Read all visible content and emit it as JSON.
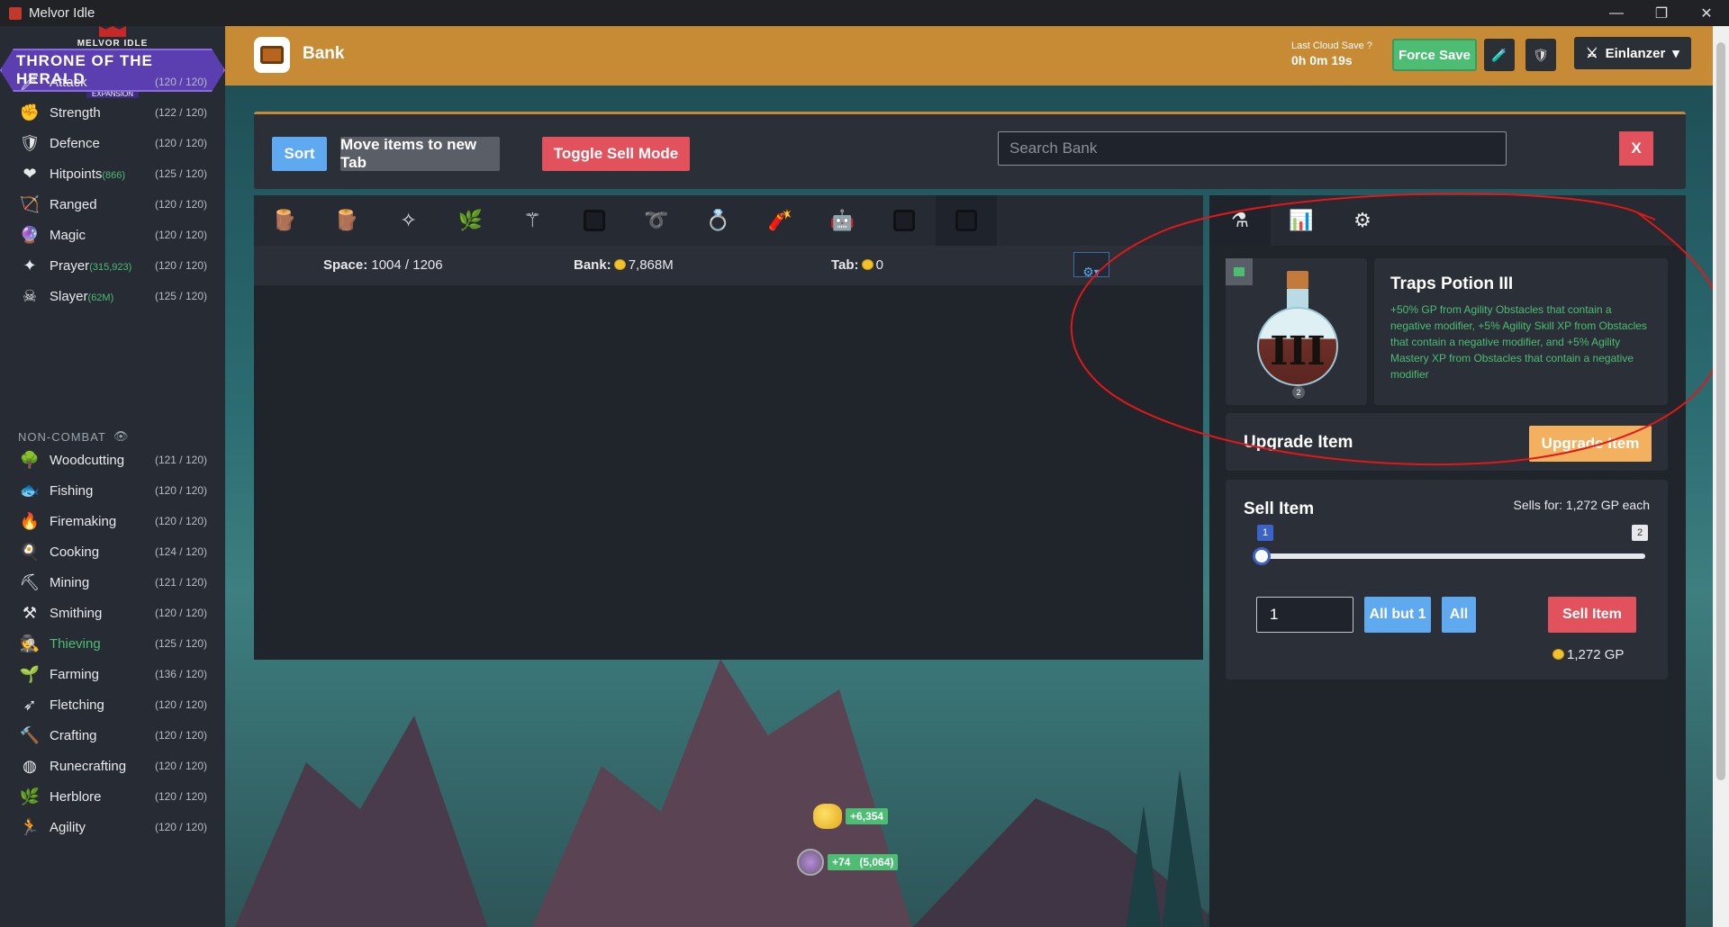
{
  "window": {
    "title": "Melvor Idle",
    "controls": [
      "—",
      "❐",
      "✕"
    ]
  },
  "logo": {
    "line1": "MELVOR IDLE",
    "line2": "THRONE OF THE HERALD",
    "line3": "EXPANSION"
  },
  "sidebar": {
    "combat": [
      {
        "name": "Attack",
        "extra": "",
        "level": "(120 / 120)",
        "icon": "sword-icon",
        "glyph": "🗡"
      },
      {
        "name": "Strength",
        "extra": "",
        "level": "(122 / 120)",
        "icon": "fist-icon",
        "glyph": "✊"
      },
      {
        "name": "Defence",
        "extra": "",
        "level": "(120 / 120)",
        "icon": "shield-icon",
        "glyph": "🛡"
      },
      {
        "name": "Hitpoints",
        "extra": "(866)",
        "level": "(125 / 120)",
        "icon": "heart-icon",
        "glyph": "❤"
      },
      {
        "name": "Ranged",
        "extra": "",
        "level": "(120 / 120)",
        "icon": "bow-icon",
        "glyph": "🏹"
      },
      {
        "name": "Magic",
        "extra": "",
        "level": "(120 / 120)",
        "icon": "wizard-hat-icon",
        "glyph": "🔮"
      },
      {
        "name": "Prayer",
        "extra": "(315,923)",
        "level": "(120 / 120)",
        "icon": "sparkle-icon",
        "glyph": "✦"
      },
      {
        "name": "Slayer",
        "extra": "(62M)",
        "level": "(125 / 120)",
        "icon": "slayer-icon",
        "glyph": "☠"
      }
    ],
    "noncombat_header": "NON-COMBAT",
    "noncombat": [
      {
        "name": "Woodcutting",
        "level": "(121 / 120)",
        "icon": "tree-icon",
        "glyph": "🌳"
      },
      {
        "name": "Fishing",
        "level": "(120 / 120)",
        "icon": "fish-icon",
        "glyph": "🐟"
      },
      {
        "name": "Firemaking",
        "level": "(120 / 120)",
        "icon": "fire-icon",
        "glyph": "🔥"
      },
      {
        "name": "Cooking",
        "level": "(124 / 120)",
        "icon": "chef-hat-icon",
        "glyph": "🍳"
      },
      {
        "name": "Mining",
        "level": "(121 / 120)",
        "icon": "pickaxe-icon",
        "glyph": "⛏"
      },
      {
        "name": "Smithing",
        "level": "(120 / 120)",
        "icon": "anvil-icon",
        "glyph": "⚒"
      },
      {
        "name": "Thieving",
        "level": "(125 / 120)",
        "icon": "thief-icon",
        "glyph": "🕵"
      },
      {
        "name": "Farming",
        "level": "(136 / 120)",
        "icon": "sprout-icon",
        "glyph": "🌱"
      },
      {
        "name": "Fletching",
        "level": "(120 / 120)",
        "icon": "arrow-icon",
        "glyph": "➶"
      },
      {
        "name": "Crafting",
        "level": "(120 / 120)",
        "icon": "tools-icon",
        "glyph": "🔨"
      },
      {
        "name": "Runecrafting",
        "level": "(120 / 120)",
        "icon": "rune-icon",
        "glyph": "◍"
      },
      {
        "name": "Herblore",
        "level": "(120 / 120)",
        "icon": "herb-icon",
        "glyph": "🌿"
      },
      {
        "name": "Agility",
        "level": "(120 / 120)",
        "icon": "runner-icon",
        "glyph": "🏃"
      }
    ]
  },
  "topbar": {
    "page_title": "Bank",
    "last_save_label": "Last Cloud Save",
    "last_save_value": "0h 0m 19s",
    "force_save": "Force Save",
    "username": "Einlanzer"
  },
  "bank": {
    "sort": "Sort",
    "move": "Move items to new Tab",
    "toggle_sell": "Toggle Sell Mode",
    "search_placeholder": "Search Bank",
    "search_clear": "X",
    "space_label": "Space:",
    "space_value": "1004 / 1206",
    "bank_label": "Bank:",
    "bank_value": "7,868M",
    "tab_label": "Tab:",
    "tab_value": "0",
    "tabs": [
      {
        "icon": "log-slice-icon",
        "glyph": "🪵"
      },
      {
        "icon": "wood-log-icon",
        "glyph": "🪵"
      },
      {
        "icon": "gem-cluster-icon",
        "glyph": "✧"
      },
      {
        "icon": "herb-seed-icon",
        "glyph": "🌿"
      },
      {
        "icon": "staff-icon",
        "glyph": "⚚"
      },
      {
        "icon": "empty-tab-icon",
        "glyph": ""
      },
      {
        "icon": "rope-icon",
        "glyph": "➰"
      },
      {
        "icon": "ring-icon",
        "glyph": "💍"
      },
      {
        "icon": "bolts-icon",
        "glyph": "🧨"
      },
      {
        "icon": "armour-icon",
        "glyph": "🤖"
      },
      {
        "icon": "empty-tab-icon",
        "glyph": ""
      },
      {
        "icon": "empty-tab-icon",
        "glyph": ""
      }
    ]
  },
  "floating": {
    "gp_gain": "+6,354",
    "xp_gain": "+74",
    "xp_total": "(5,064)"
  },
  "item_panel": {
    "tabs": [
      {
        "icon": "potion-tab-icon",
        "glyph": "⚗"
      },
      {
        "icon": "stats-chart-icon",
        "glyph": "📊"
      },
      {
        "icon": "gear-icon",
        "glyph": "⚙"
      }
    ],
    "potion_numeral": "III",
    "quantity": "2",
    "item_name": "Traps Potion III",
    "item_desc": "+50% GP from Agility Obstacles that contain a negative modifier, +5% Agility Skill XP from Obstacles that contain a negative modifier, and +5% Agility Mastery XP from Obstacles that contain a negative modifier",
    "upgrade_label": "Upgrade Item",
    "upgrade_button": "Upgrade Item",
    "sell_label": "Sell Item",
    "sells_for": "Sells for: 1,272 GP each",
    "slider_min": "1",
    "slider_max": "2",
    "quantity_input": "1",
    "all_but_one": "All but 1",
    "all": "All",
    "sell_button": "Sell Item",
    "sell_total": "1,272 GP"
  },
  "colors": {
    "accent_gold": "#c78b35",
    "green": "#4dbd74",
    "red": "#e2525c",
    "blue": "#5fa9f0",
    "annotation": "#e01818"
  }
}
